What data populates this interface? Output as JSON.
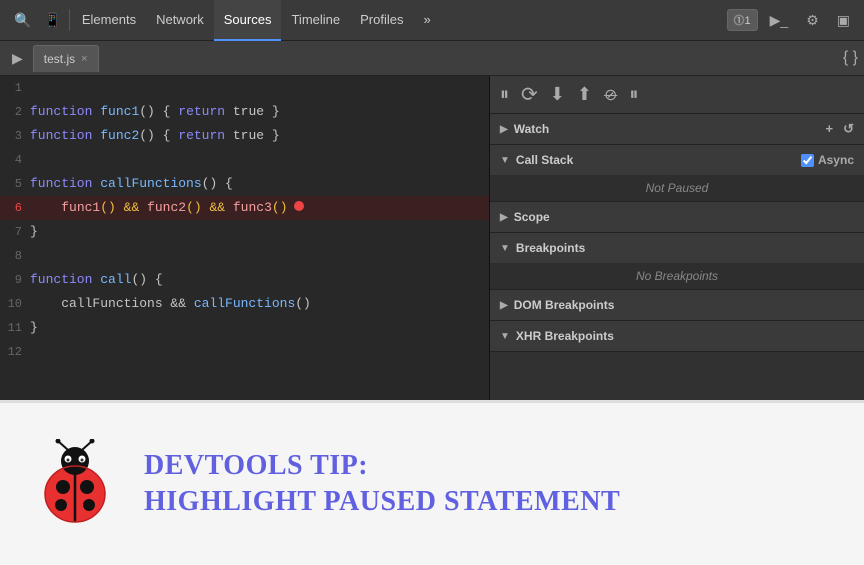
{
  "toolbar": {
    "tabs": [
      {
        "label": "Elements",
        "active": false
      },
      {
        "label": "Network",
        "active": false
      },
      {
        "label": "Sources",
        "active": true
      },
      {
        "label": "Timeline",
        "active": false
      },
      {
        "label": "Profiles",
        "active": false
      },
      {
        "label": "»",
        "active": false
      }
    ],
    "badge": "⓵1",
    "icons": [
      "search",
      "mobile",
      "gear",
      "monitor"
    ]
  },
  "sources_tab": {
    "filename": "test.js",
    "close_label": "×"
  },
  "debug": {
    "pause_label": "⏸",
    "step_over_label": "⟳",
    "step_into_label": "↓",
    "step_out_label": "↑",
    "deactivate_label": "⊘",
    "resume_label": "⏸"
  },
  "code": {
    "lines": [
      {
        "num": 1,
        "content": ""
      },
      {
        "num": 2,
        "content": "function func1() { return true }"
      },
      {
        "num": 3,
        "content": "function func2() { return true }"
      },
      {
        "num": 4,
        "content": ""
      },
      {
        "num": 5,
        "content": "function callFunctions() {"
      },
      {
        "num": 6,
        "content": "    func1() && func2() && func3()",
        "highlight": true,
        "error": true
      },
      {
        "num": 7,
        "content": "}"
      },
      {
        "num": 8,
        "content": ""
      },
      {
        "num": 9,
        "content": "function call() {"
      },
      {
        "num": 10,
        "content": "    callFunctions && callFunctions()"
      },
      {
        "num": 11,
        "content": "}"
      },
      {
        "num": 12,
        "content": ""
      }
    ]
  },
  "panels": {
    "watch": {
      "label": "Watch",
      "add": "+",
      "refresh": "↺"
    },
    "call_stack": {
      "label": "Call Stack",
      "async_label": "Async",
      "status": "Not Paused"
    },
    "scope": {
      "label": "Scope"
    },
    "breakpoints": {
      "label": "Breakpoints",
      "status": "No Breakpoints"
    },
    "dom_breakpoints": {
      "label": "DOM Breakpoints"
    },
    "xhr_breakpoints": {
      "label": "XHR Breakpoints"
    }
  },
  "tip": {
    "title": "DevTools Tip:",
    "subtitle": "Highlight Paused Statement"
  }
}
